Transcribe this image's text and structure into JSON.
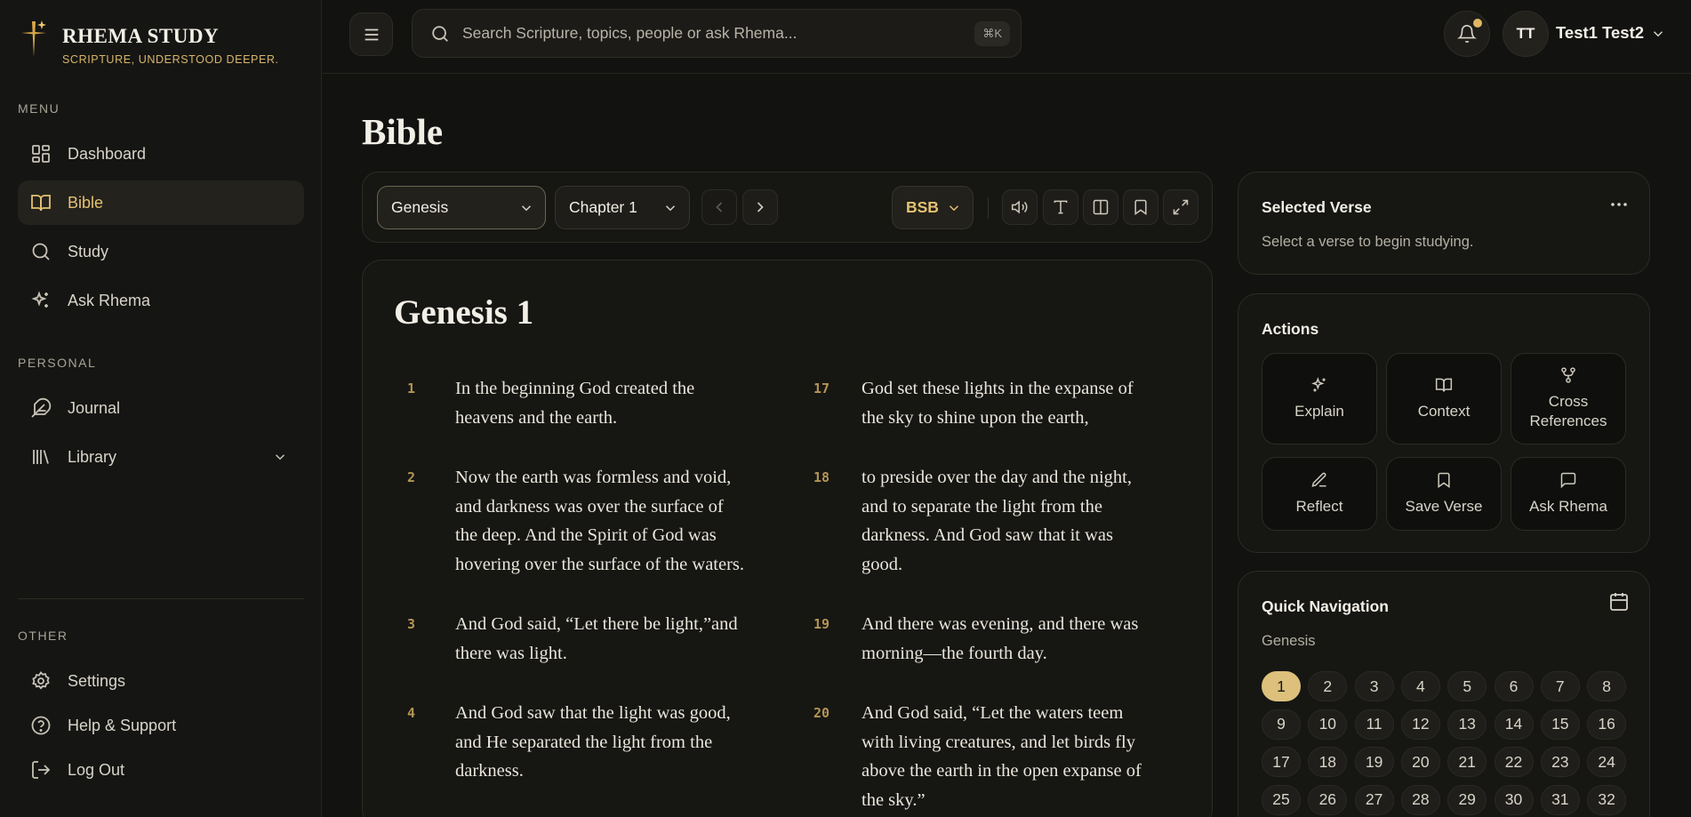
{
  "brand": {
    "name": "RHEMA STUDY",
    "tagline": "SCRIPTURE, UNDERSTOOD DEEPER."
  },
  "sidebar": {
    "menu_label": "MENU",
    "menu_items": [
      {
        "label": "Dashboard",
        "icon": "dashboard-icon"
      },
      {
        "label": "Bible",
        "icon": "book-open-icon",
        "active": true
      },
      {
        "label": "Study",
        "icon": "search-icon"
      },
      {
        "label": "Ask Rhema",
        "icon": "sparkles-icon"
      }
    ],
    "personal_label": "PERSONAL",
    "personal_items": [
      {
        "label": "Journal",
        "icon": "feather-icon"
      },
      {
        "label": "Library",
        "icon": "library-icon"
      }
    ],
    "other_label": "OTHER",
    "other_items": [
      {
        "label": "Settings",
        "icon": "gear-icon"
      },
      {
        "label": "Help & Support",
        "icon": "help-circle-icon"
      },
      {
        "label": "Log Out",
        "icon": "logout-icon"
      }
    ]
  },
  "topbar": {
    "search_placeholder": "Search Scripture, topics, people or ask Rhema...",
    "search_shortcut": "⌘K",
    "notification_dot_color": "#e0b865",
    "user": {
      "initials": "TT",
      "name": "Test1 Test2"
    }
  },
  "main": {
    "title": "Bible",
    "toolbar": {
      "book": "Genesis",
      "chapter": "Chapter 1",
      "version": "BSB"
    },
    "chapter_title": "Genesis 1",
    "verses_left": [
      {
        "num": "1",
        "text": "In the beginning God created the heavens and the earth."
      },
      {
        "num": "2",
        "text": "Now the earth was formless and void, and darkness was over the surface of the deep. And the Spirit of God was hovering over the surface of the waters."
      },
      {
        "num": "3",
        "text": "And God said, “Let there be light,”and there was light."
      },
      {
        "num": "4",
        "text": "And God saw that the light was good, and He separated the light from the darkness."
      }
    ],
    "verses_right": [
      {
        "num": "17",
        "text": "God set these lights in the expanse of the sky to shine upon the earth,"
      },
      {
        "num": "18",
        "text": "to preside over the day and the night, and to separate the light from the darkness. And God saw that it was good."
      },
      {
        "num": "19",
        "text": "And there was evening, and there was morning—the fourth day."
      },
      {
        "num": "20",
        "text": "And God said, “Let the waters teem with living creatures, and let birds fly above the earth in the open expanse of the sky.”"
      }
    ]
  },
  "panel": {
    "selected_verse": {
      "title": "Selected Verse",
      "hint": "Select a verse to begin studying."
    },
    "actions": {
      "title": "Actions",
      "items": [
        {
          "label": "Explain",
          "icon": "sparkles-icon"
        },
        {
          "label": "Context",
          "icon": "book-open-icon"
        },
        {
          "label": "Cross References",
          "icon": "branch-icon"
        },
        {
          "label": "Reflect",
          "icon": "pen-icon"
        },
        {
          "label": "Save Verse",
          "icon": "bookmark-icon"
        },
        {
          "label": "Ask Rhema",
          "icon": "message-icon"
        }
      ]
    },
    "quick_nav": {
      "title": "Quick Navigation",
      "book": "Genesis",
      "chapters": [
        "1",
        "2",
        "3",
        "4",
        "5",
        "6",
        "7",
        "8",
        "9",
        "10",
        "11",
        "12",
        "13",
        "14",
        "15",
        "16",
        "17",
        "18",
        "19",
        "20",
        "21",
        "22",
        "23",
        "24",
        "25",
        "26",
        "27",
        "28",
        "29",
        "30",
        "31",
        "32"
      ],
      "active_chapter": "1"
    }
  },
  "colors": {
    "accent": "#e3c172",
    "background": "#121210",
    "panel": "#161613"
  }
}
